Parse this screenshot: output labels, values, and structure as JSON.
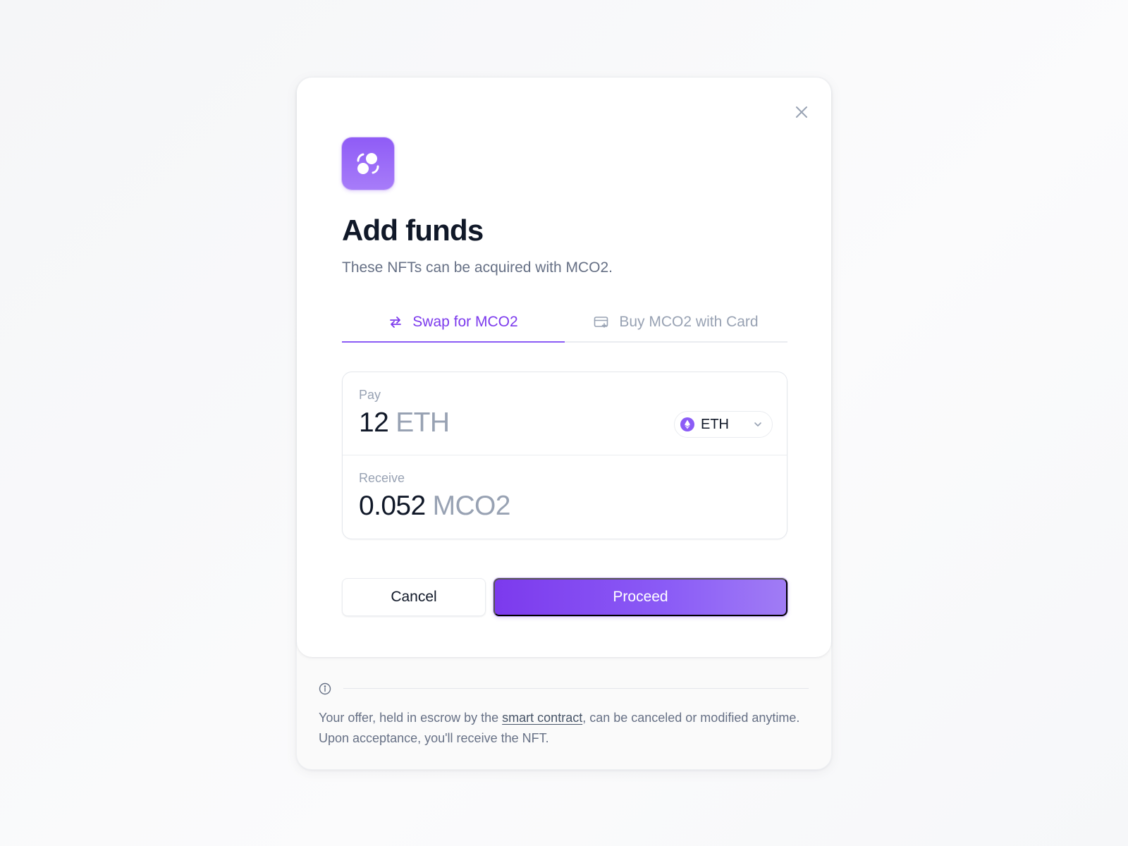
{
  "modal": {
    "title": "Add funds",
    "subtitle": "These NFTs can be acquired with MCO2.",
    "close_icon": "close-icon",
    "app_icon": "swap-coins-icon",
    "accent_color": "#7c3aed"
  },
  "tabs": [
    {
      "label": "Swap for MCO2",
      "icon": "swap-arrows-icon",
      "active": true
    },
    {
      "label": "Buy MCO2 with Card",
      "icon": "credit-card-icon",
      "active": false
    }
  ],
  "swap": {
    "pay": {
      "label": "Pay",
      "amount": "12",
      "unit": "ETH"
    },
    "token_select": {
      "value": "ETH",
      "icon": "ethereum-icon"
    },
    "receive": {
      "label": "Receive",
      "amount": "0.052",
      "unit": "MCO2"
    }
  },
  "actions": {
    "cancel_label": "Cancel",
    "proceed_label": "Proceed"
  },
  "footer": {
    "info_icon": "info-icon",
    "text_before": "Your offer, held in escrow by the ",
    "link_text": "smart contract",
    "text_after": ", can be canceled or modified anytime. Upon acceptance, you'll receive the NFT."
  }
}
